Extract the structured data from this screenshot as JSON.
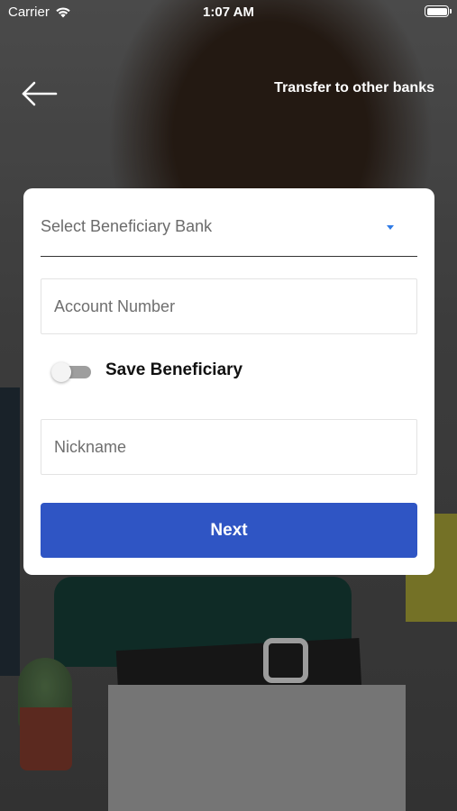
{
  "status_bar": {
    "carrier": "Carrier",
    "time": "1:07 AM"
  },
  "header": {
    "title": "Transfer to other banks",
    "back_icon": "arrow-left-icon"
  },
  "form": {
    "bank_select": {
      "placeholder": "Select Beneficiary Bank",
      "caret_icon": "caret-down-icon",
      "caret_color": "#2f7be6"
    },
    "account_number": {
      "placeholder": "Account Number",
      "value": ""
    },
    "save_beneficiary": {
      "label": "Save Beneficiary",
      "enabled": false
    },
    "nickname": {
      "placeholder": "Nickname",
      "value": ""
    },
    "next_button": {
      "label": "Next",
      "color": "#2f55c4"
    }
  }
}
